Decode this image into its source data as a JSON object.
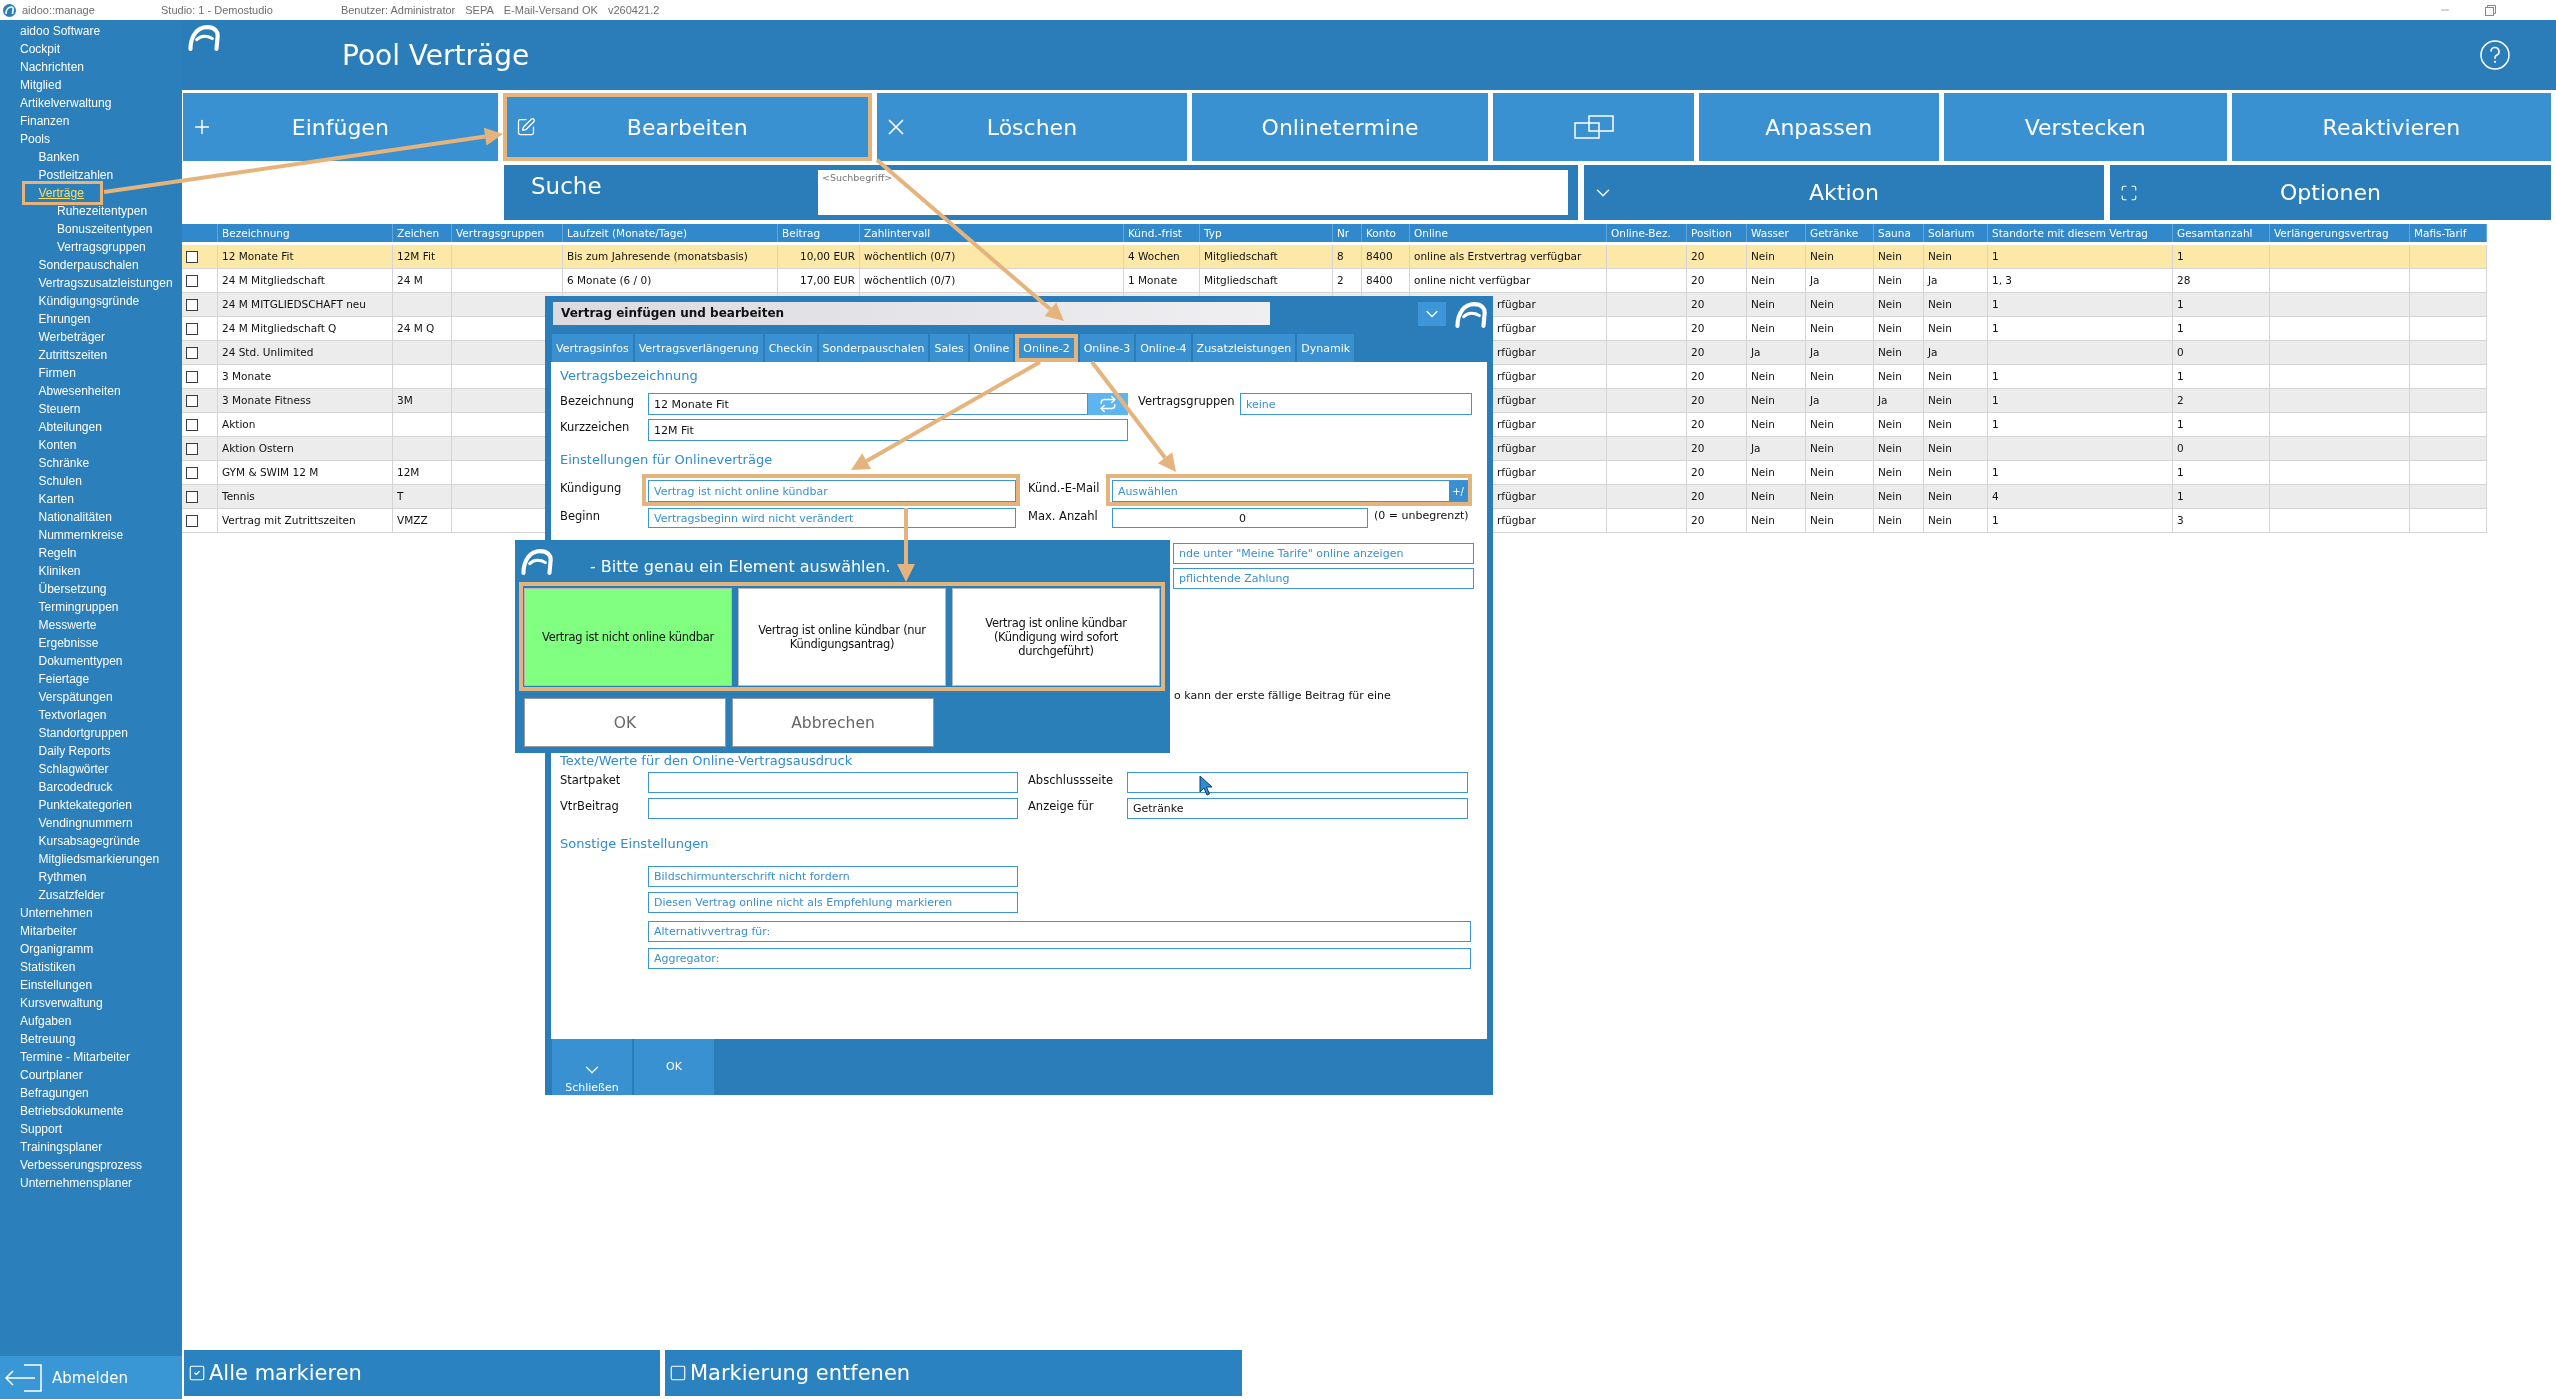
{
  "title_bar": {
    "app_name": "aidoo::manage",
    "info": [
      "Studio: 1 - Demostudio",
      "Benutzer: Administrator",
      "SEPA",
      "E-Mail-Versand OK",
      "v260421.2"
    ]
  },
  "sidebar": {
    "items": [
      {
        "label": "aidoo Software",
        "selected": false
      },
      {
        "label": "Cockpit",
        "selected": false
      },
      {
        "label": "Nachrichten",
        "selected": false
      },
      {
        "label": "Mitglied",
        "selected": false
      },
      {
        "label": "Artikelverwaltung",
        "selected": false
      },
      {
        "label": "Finanzen",
        "selected": false
      },
      {
        "label": "Pools",
        "selected": false,
        "children": [
          {
            "label": "Banken",
            "selected": false
          },
          {
            "label": "Postleitzahlen",
            "selected": false
          },
          {
            "label": "Verträge",
            "selected": true,
            "children": [
              {
                "label": "Ruhezeitentypen",
                "selected": false
              },
              {
                "label": "Bonuszeitentypen",
                "selected": false
              },
              {
                "label": "Vertragsgruppen",
                "selected": false
              }
            ]
          },
          {
            "label": "Sonderpauschalen",
            "selected": false
          },
          {
            "label": "Vertragszusatzleistungen",
            "selected": false
          },
          {
            "label": "Kündigungsgründe",
            "selected": false
          },
          {
            "label": "Ehrungen",
            "selected": false
          },
          {
            "label": "Werbeträger",
            "selected": false
          },
          {
            "label": "Zutrittszeiten",
            "selected": false
          },
          {
            "label": "Firmen",
            "selected": false
          },
          {
            "label": "Abwesenheiten",
            "selected": false
          },
          {
            "label": "Steuern",
            "selected": false
          },
          {
            "label": "Abteilungen",
            "selected": false
          },
          {
            "label": "Konten",
            "selected": false
          },
          {
            "label": "Schränke",
            "selected": false
          },
          {
            "label": "Schulen",
            "selected": false
          },
          {
            "label": "Karten",
            "selected": false
          },
          {
            "label": "Nationalitäten",
            "selected": false
          },
          {
            "label": "Nummernkreise",
            "selected": false
          },
          {
            "label": "Regeln",
            "selected": false
          },
          {
            "label": "Kliniken",
            "selected": false
          },
          {
            "label": "Übersetzung",
            "selected": false
          },
          {
            "label": "Termingruppen",
            "selected": false
          },
          {
            "label": "Messwerte",
            "selected": false
          },
          {
            "label": "Ergebnisse",
            "selected": false
          },
          {
            "label": "Dokumenttypen",
            "selected": false
          },
          {
            "label": "Feiertage",
            "selected": false
          },
          {
            "label": "Verspätungen",
            "selected": false
          },
          {
            "label": "Textvorlagen",
            "selected": false
          },
          {
            "label": "Standortgruppen",
            "selected": false
          },
          {
            "label": "Daily Reports",
            "selected": false
          },
          {
            "label": "Schlagwörter",
            "selected": false
          },
          {
            "label": "Barcodedruck",
            "selected": false
          },
          {
            "label": "Punktekategorien",
            "selected": false
          },
          {
            "label": "Vendingnummern",
            "selected": false
          },
          {
            "label": "Kursabsagegründe",
            "selected": false
          },
          {
            "label": "Mitgliedsmarkierungen",
            "selected": false
          },
          {
            "label": "Rythmen",
            "selected": false
          },
          {
            "label": "Zusatzfelder",
            "selected": false
          }
        ]
      },
      {
        "label": "Unternehmen",
        "selected": false
      },
      {
        "label": "Mitarbeiter",
        "selected": false
      },
      {
        "label": "Organigramm",
        "selected": false
      },
      {
        "label": "Statistiken",
        "selected": false
      },
      {
        "label": "Einstellungen",
        "selected": false
      },
      {
        "label": "Kursverwaltung",
        "selected": false
      },
      {
        "label": "Aufgaben",
        "selected": false
      },
      {
        "label": "Betreuung",
        "selected": false
      },
      {
        "label": "Termine - Mitarbeiter",
        "selected": false
      },
      {
        "label": "Courtplaner",
        "selected": false
      },
      {
        "label": "Befragungen",
        "selected": false
      },
      {
        "label": "Betriebsdokumente",
        "selected": false
      },
      {
        "label": "Support",
        "selected": false
      },
      {
        "label": "Trainingsplaner",
        "selected": false
      },
      {
        "label": "Verbesserungsprozess",
        "selected": false
      },
      {
        "label": "Unternehmensplaner",
        "selected": false
      }
    ],
    "logout": "Abmelden"
  },
  "header": {
    "title": "Pool Verträge"
  },
  "toolbar": [
    {
      "label": "Einfügen",
      "highlighted": false
    },
    {
      "label": "Bearbeiten",
      "highlighted": true
    },
    {
      "label": "Löschen",
      "highlighted": false
    },
    {
      "label": "Onlinetermine",
      "highlighted": false
    },
    {
      "highlighted": false
    },
    {
      "label": "Anpassen",
      "highlighted": false
    },
    {
      "label": "Verstecken",
      "highlighted": false
    },
    {
      "label": "Reaktivieren",
      "highlighted": false
    }
  ],
  "search": {
    "label": "Suche",
    "placeholder": "<Suchbegriff>"
  },
  "actions": [
    "Aktion",
    "Optionen"
  ],
  "table": {
    "columns": [
      "Bezeichnung",
      "Zeichen",
      "Vertragsgruppen",
      "Laufzeit (Monate/Tage)",
      "Beitrag",
      "Zahlintervall",
      "Künd.-frist",
      "Typ",
      "Nr",
      "Konto",
      "Online",
      "Online-Bez.",
      "Position",
      "Wasser",
      "Getränke",
      "Sauna",
      "Solarium",
      "Standorte mit diesem Vertrag",
      "Gesamtanzahl",
      "Verlängerungsvertrag",
      "Mafis-Tarif"
    ],
    "rows": [
      {
        "selected": true,
        "checked": false,
        "covered_by_dialog": false,
        "cells": [
          "12 Monate Fit",
          "12M Fit",
          null,
          "Bis zum Jahresende (monatsbasis)",
          "10,00 EUR",
          "wöchentlich (0/7)",
          "4 Wochen",
          "Mitgliedschaft",
          "8",
          "8400",
          "online als Erstvertrag verfügbar",
          null,
          "20",
          "Nein",
          "Nein",
          "Nein",
          "Nein",
          "1",
          "1"
        ]
      },
      {
        "selected": false,
        "checked": false,
        "covered_by_dialog": false,
        "cells": [
          "24 M Mitgliedschaft",
          "24 M",
          null,
          "6 Monate (6 / 0)",
          "17,00 EUR",
          "wöchentlich (0/7)",
          "1 Monate",
          "Mitgliedschaft",
          "2",
          "8400",
          "online nicht verfügbar",
          null,
          "20",
          "Nein",
          "Ja",
          "Nein",
          "Ja",
          "1, 3",
          "28"
        ]
      },
      {
        "selected": false,
        "checked": false,
        "covered_by_dialog": true,
        "cells": [
          "24 M MITGLIEDSCHAFT neu",
          null,
          null,
          null,
          null,
          null,
          null,
          null,
          null,
          null,
          "rfügbar",
          null,
          "20",
          "Nein",
          "Nein",
          "Nein",
          "Nein",
          "1",
          "1"
        ]
      },
      {
        "selected": false,
        "checked": false,
        "covered_by_dialog": true,
        "cells": [
          "24 M Mitgliedschaft Q",
          "24 M Q",
          null,
          null,
          null,
          null,
          null,
          null,
          null,
          null,
          "rfügbar",
          null,
          "20",
          "Nein",
          "Nein",
          "Nein",
          "Nein",
          "1",
          "1"
        ]
      },
      {
        "selected": false,
        "checked": false,
        "covered_by_dialog": true,
        "cells": [
          "24 Std. Unlimited",
          null,
          null,
          null,
          null,
          null,
          null,
          null,
          null,
          null,
          "rfügbar",
          null,
          "20",
          "Ja",
          "Ja",
          "Nein",
          "Ja",
          null,
          "0"
        ]
      },
      {
        "selected": false,
        "checked": false,
        "covered_by_dialog": true,
        "cells": [
          "3 Monate",
          null,
          null,
          null,
          null,
          null,
          null,
          null,
          null,
          null,
          "rfügbar",
          null,
          "20",
          "Nein",
          "Nein",
          "Nein",
          "Nein",
          "1",
          "1"
        ]
      },
      {
        "selected": false,
        "checked": false,
        "covered_by_dialog": true,
        "cells": [
          "3 Monate Fitness",
          "3M",
          null,
          null,
          null,
          null,
          null,
          null,
          null,
          null,
          "rfügbar",
          null,
          "20",
          "Nein",
          "Ja",
          "Ja",
          "Nein",
          "1",
          "2"
        ]
      },
      {
        "selected": false,
        "checked": false,
        "covered_by_dialog": true,
        "cells": [
          "Aktion",
          null,
          null,
          null,
          null,
          null,
          null,
          null,
          null,
          null,
          "rfügbar",
          null,
          "20",
          "Nein",
          "Nein",
          "Nein",
          "Nein",
          "1",
          "1"
        ]
      },
      {
        "selected": false,
        "checked": false,
        "covered_by_dialog": true,
        "cells": [
          "Aktion Ostern",
          null,
          null,
          null,
          null,
          null,
          null,
          null,
          null,
          null,
          "rfügbar",
          null,
          "20",
          "Ja",
          "Nein",
          "Nein",
          "Nein",
          null,
          "0"
        ]
      },
      {
        "selected": false,
        "checked": false,
        "covered_by_dialog": true,
        "cells": [
          "GYM & SWIM 12 M",
          "12M",
          null,
          null,
          null,
          null,
          null,
          null,
          null,
          null,
          "rfügbar",
          null,
          "20",
          "Nein",
          "Nein",
          "Nein",
          "Nein",
          "1",
          "1"
        ]
      },
      {
        "selected": false,
        "checked": false,
        "covered_by_dialog": true,
        "cells": [
          "Tennis",
          "T",
          null,
          null,
          null,
          null,
          null,
          null,
          null,
          null,
          "rfügbar",
          null,
          "20",
          "Nein",
          "Nein",
          "Nein",
          "Nein",
          "4",
          "1"
        ]
      },
      {
        "selected": false,
        "checked": false,
        "covered_by_dialog": true,
        "cells": [
          "Vertrag mit Zutrittszeiten",
          "VMZZ",
          null,
          null,
          null,
          null,
          null,
          null,
          null,
          null,
          "rfügbar",
          null,
          "20",
          "Nein",
          "Nein",
          "Nein",
          "Nein",
          "1",
          "3"
        ]
      }
    ]
  },
  "dialog": {
    "title": "Vertrag einfügen und bearbeiten",
    "tabs": [
      {
        "label": "Vertragsinfos",
        "highlighted": false
      },
      {
        "label": "Vertragsverlängerung",
        "highlighted": false
      },
      {
        "label": "Checkin",
        "highlighted": false
      },
      {
        "label": "Sonderpauschalen",
        "highlighted": false
      },
      {
        "label": "Sales",
        "highlighted": false
      },
      {
        "label": "Online",
        "highlighted": false
      },
      {
        "label": "Online-2",
        "highlighted": true
      },
      {
        "label": "Online-3",
        "highlighted": false
      },
      {
        "label": "Online-4",
        "highlighted": false
      },
      {
        "label": "Zusatzleistungen",
        "highlighted": false
      },
      {
        "label": "Dynamik",
        "highlighted": false
      }
    ],
    "name_section": {
      "heading": "Vertragsbezeichnung",
      "name": {
        "label": "Bezeichnung",
        "value": "12 Monate Fit"
      },
      "groups": {
        "label": "Vertragsgruppen",
        "value": "keine"
      },
      "short_name": {
        "label": "Kurzzeichen",
        "value": "12M Fit"
      }
    },
    "online_section": {
      "heading": "Einstellungen für Onlineverträge",
      "cancellation": {
        "label": "Kündigung",
        "value": "Vertrag ist nicht online kündbar",
        "highlighted": true
      },
      "cancellation_email": {
        "label": "Künd.-E-Mail",
        "value": "Auswählen",
        "button": "+/",
        "highlighted": true
      },
      "start": {
        "label": "Beginn",
        "value": "Vertragsbeginn wird nicht verändert"
      },
      "max_count": {
        "label": "Max. Anzahl",
        "value": "0",
        "note": "(0 = unbegrenzt)"
      },
      "toggles": [
        "nde unter \"Meine Tarife\" online anzeigen",
        "pflichtende Zahlung"
      ],
      "note": "o kann der erste fällige Beitrag für eine"
    },
    "print_section": {
      "heading": "Texte/Werte für den Online-Vertragsausdruck",
      "fields": [
        {
          "label": "Startpaket"
        },
        {
          "label": "Abschlussseite"
        },
        {
          "label": "VtrBeitrag"
        },
        {
          "label": "Anzeige für",
          "value": "Getränke"
        }
      ]
    },
    "other_section": {
      "heading": "Sonstige Einstellungen",
      "toggles": [
        "Bildschirmunterschrift nicht fordern",
        "Diesen Vertrag online nicht als Empfehlung markieren"
      ],
      "selectors": [
        "Alternativvertrag für:",
        "Aggregator:"
      ]
    },
    "footer_buttons": [
      "Schließen",
      "OK"
    ]
  },
  "popup": {
    "title": "- Bitte genau ein Element auswählen.",
    "options": [
      {
        "label": "Vertrag ist nicht online kündbar",
        "selected": true
      },
      {
        "label": "Vertrag ist online kündbar (nur Kündigungsantrag)",
        "selected": false
      },
      {
        "label": "Vertrag ist online kündbar (Kündigung wird sofort durchgeführt)",
        "selected": false
      }
    ],
    "options_highlighted": true,
    "buttons": [
      "OK",
      "Abbrechen"
    ]
  },
  "bottom_bar": [
    "Alle markieren",
    "Markierung entfenen"
  ]
}
